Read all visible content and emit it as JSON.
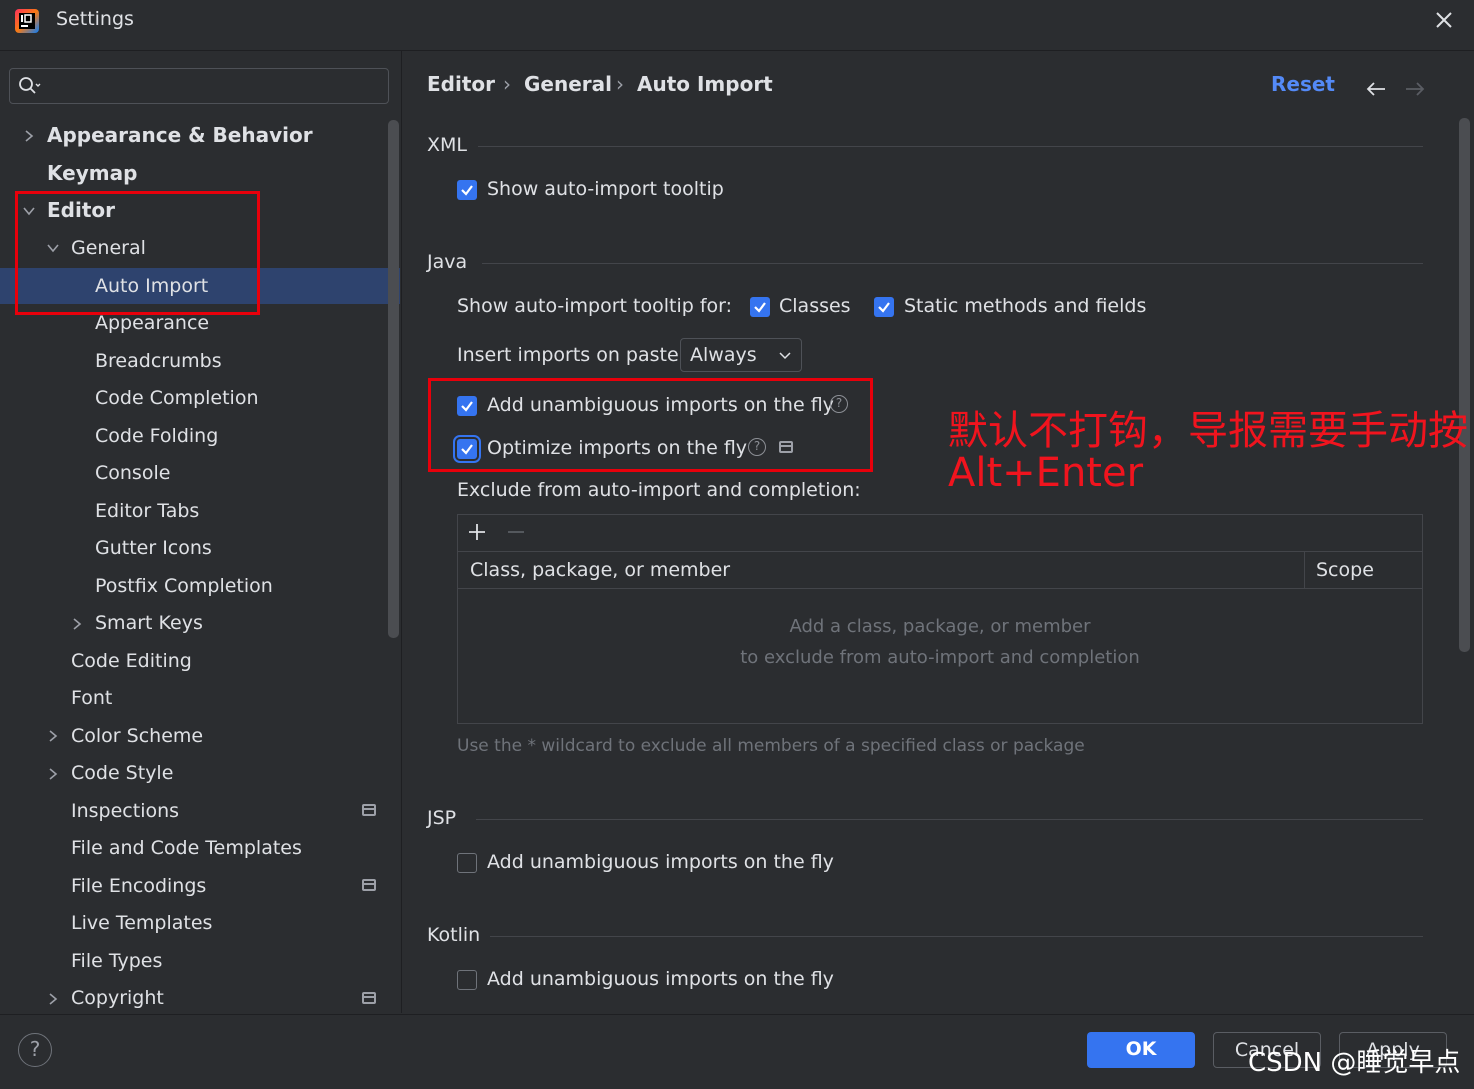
{
  "window": {
    "title": "Settings"
  },
  "search": {
    "placeholder": ""
  },
  "tree": {
    "appearance_behavior": "Appearance & Behavior",
    "keymap": "Keymap",
    "editor": "Editor",
    "general": "General",
    "auto_import": "Auto Import",
    "appearance": "Appearance",
    "breadcrumbs": "Breadcrumbs",
    "code_completion": "Code Completion",
    "code_folding": "Code Folding",
    "console": "Console",
    "editor_tabs": "Editor Tabs",
    "gutter_icons": "Gutter Icons",
    "postfix_completion": "Postfix Completion",
    "smart_keys": "Smart Keys",
    "code_editing": "Code Editing",
    "font": "Font",
    "color_scheme": "Color Scheme",
    "code_style": "Code Style",
    "inspections": "Inspections",
    "file_code_templates": "File and Code Templates",
    "file_encodings": "File Encodings",
    "live_templates": "Live Templates",
    "file_types": "File Types",
    "copyright": "Copyright"
  },
  "breadcrumb": {
    "items": [
      "Editor",
      "General",
      "Auto Import"
    ],
    "separator": "›"
  },
  "header": {
    "reset": "Reset",
    "back_icon": "arrow-left-icon",
    "forward_icon": "arrow-right-icon"
  },
  "xml": {
    "section": "XML",
    "show_tooltip": {
      "label": "Show auto-import tooltip",
      "checked": true
    }
  },
  "java": {
    "section": "Java",
    "tooltip_for_label": "Show auto-import tooltip for:",
    "classes": {
      "label": "Classes",
      "checked": true
    },
    "static_methods": {
      "label": "Static methods and fields",
      "checked": true
    },
    "insert_on_paste_label": "Insert imports on paste:",
    "insert_on_paste_value": "Always",
    "add_unambiguous": {
      "label": "Add unambiguous imports on the fly",
      "checked": true
    },
    "optimize_imports": {
      "label": "Optimize imports on the fly",
      "checked": true
    },
    "exclude_label": "Exclude from auto-import and completion:",
    "table": {
      "columns": [
        "Class, package, or member",
        "Scope"
      ],
      "empty_line1": "Add a class, package, or member",
      "empty_line2": "to exclude from auto-import and completion"
    },
    "hint": "Use the * wildcard to exclude all members of a specified class or package"
  },
  "jsp": {
    "section": "JSP",
    "add_unambiguous": {
      "label": "Add unambiguous imports on the fly",
      "checked": false
    }
  },
  "kotlin": {
    "section": "Kotlin",
    "add_unambiguous": {
      "label": "Add unambiguous imports on the fly",
      "checked": false
    }
  },
  "annotation": {
    "line1": "默认不打钩，导报需要手动按",
    "line2": "Alt+Enter"
  },
  "footer": {
    "help": "?",
    "ok": "OK",
    "cancel": "Cancel",
    "apply": "Apply"
  },
  "watermark": "CSDN @睡觉早点",
  "colors": {
    "accent": "#3574f0",
    "selection": "#2e436e",
    "annotation_red": "#e8000b",
    "link": "#548af7"
  }
}
